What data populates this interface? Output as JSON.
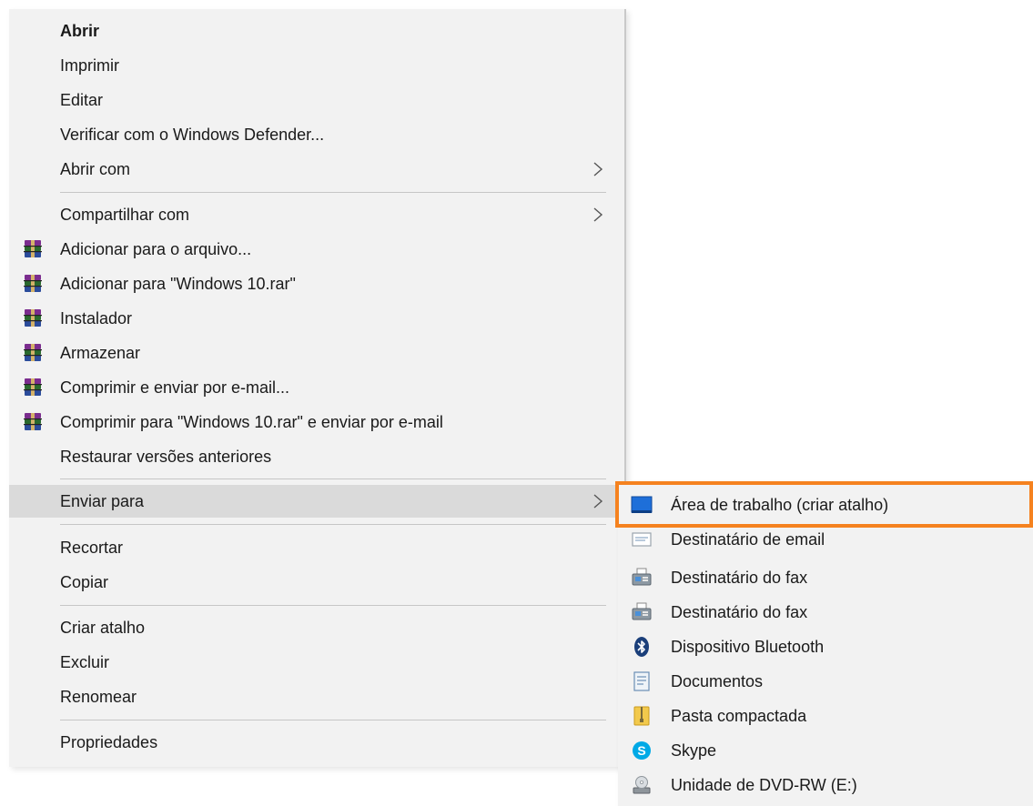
{
  "context_menu": {
    "items": [
      {
        "label": "Abrir"
      },
      {
        "label": "Imprimir"
      },
      {
        "label": "Editar"
      },
      {
        "label": "Verificar com o Windows Defender..."
      },
      {
        "label": "Abrir com"
      },
      {
        "label": "Compartilhar com"
      },
      {
        "label": "Adicionar para o arquivo..."
      },
      {
        "label": "Adicionar para \"Windows 10.rar\""
      },
      {
        "label": "Instalador"
      },
      {
        "label": "Armazenar"
      },
      {
        "label": "Comprimir e enviar por e-mail..."
      },
      {
        "label": "Comprimir para \"Windows 10.rar\" e enviar por e-mail"
      },
      {
        "label": "Restaurar versões anteriores"
      },
      {
        "label": "Enviar para"
      },
      {
        "label": "Recortar"
      },
      {
        "label": "Copiar"
      },
      {
        "label": "Criar atalho"
      },
      {
        "label": "Excluir"
      },
      {
        "label": "Renomear"
      },
      {
        "label": "Propriedades"
      }
    ]
  },
  "send_to_menu": {
    "items": [
      {
        "label": "Área de trabalho (criar atalho)",
        "icon": "desktop-icon"
      },
      {
        "label": "Destinatário de email",
        "icon": "mail-icon"
      },
      {
        "label": "Destinatário do fax",
        "icon": "fax-icon"
      },
      {
        "label": "Destinatário do fax",
        "icon": "fax-icon"
      },
      {
        "label": "Dispositivo Bluetooth",
        "icon": "bluetooth-icon"
      },
      {
        "label": "Documentos",
        "icon": "documents-icon"
      },
      {
        "label": "Pasta compactada",
        "icon": "zip-folder-icon"
      },
      {
        "label": "Skype",
        "icon": "skype-icon"
      },
      {
        "label": "Unidade de DVD-RW (E:)",
        "icon": "dvd-drive-icon"
      }
    ]
  },
  "colors": {
    "menu_background": "#f2f2f2",
    "hover_background": "#dadada",
    "highlight_outline": "#f5821f"
  }
}
